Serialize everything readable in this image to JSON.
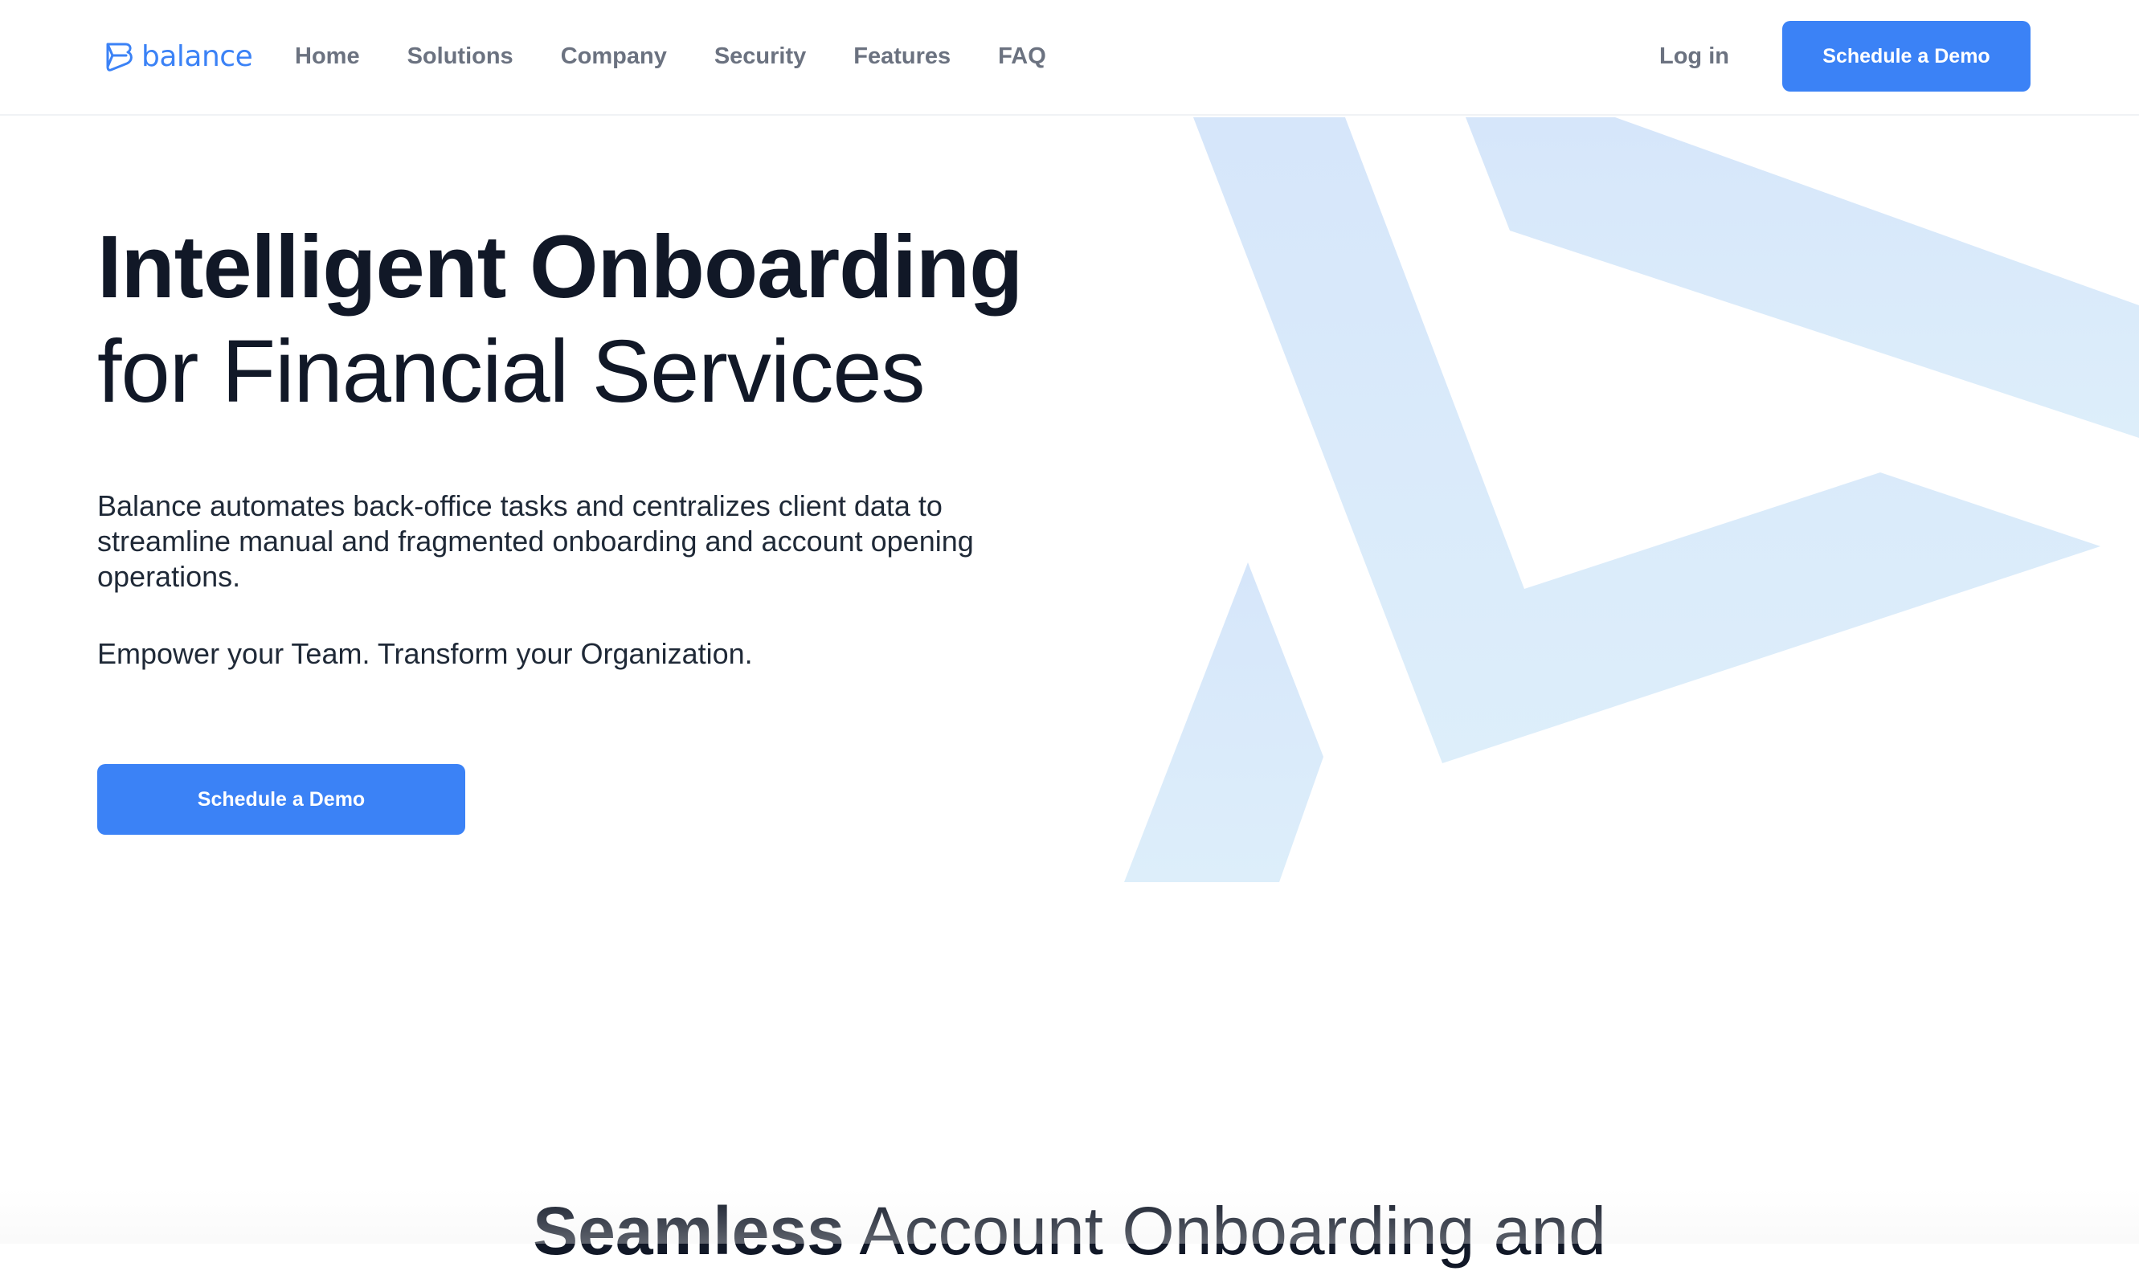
{
  "header": {
    "logo_text": "balance",
    "nav": [
      {
        "label": "Home"
      },
      {
        "label": "Solutions"
      },
      {
        "label": "Company"
      },
      {
        "label": "Security"
      },
      {
        "label": "Features"
      },
      {
        "label": "FAQ"
      }
    ],
    "login_label": "Log in",
    "cta_label": "Schedule a Demo"
  },
  "hero": {
    "title_bold": "Intelligent Onboarding",
    "title_regular": "for Financial Services",
    "description": "Balance automates back-office tasks and centralizes client data to streamline manual and fragmented onboarding and account opening operations.",
    "tagline": "Empower your Team. Transform your Organization.",
    "cta_label": "Schedule a Demo"
  },
  "next_section": {
    "title_bold": "Seamless",
    "title_regular": "Account Onboarding and"
  },
  "colors": {
    "accent": "#3b82f6",
    "text_dark": "#111827",
    "nav_text": "#6b7280",
    "bg_shape_top": "#d6e6fa",
    "bg_shape_bottom": "#dcedf9"
  },
  "icons": {
    "logo": "balance-logo-icon",
    "background": "balance-logo-shape"
  }
}
